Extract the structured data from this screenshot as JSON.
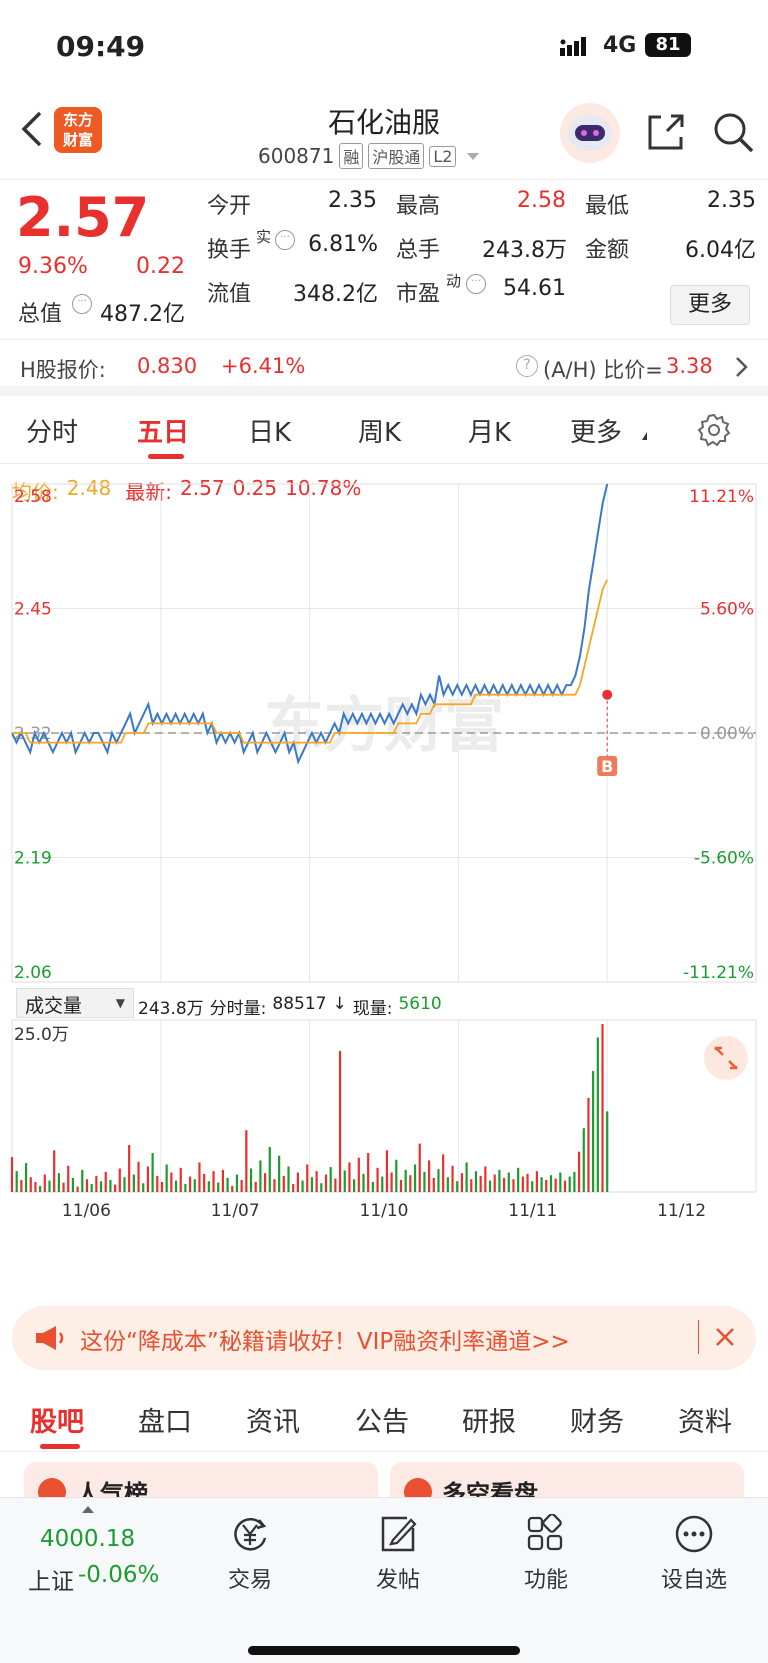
{
  "status_bar": {
    "time": "09:49",
    "network": "4G",
    "battery": "81"
  },
  "header": {
    "back_icon": "chevron-left-icon",
    "logo_text": "东方\n财富",
    "title": "石化油服",
    "code": "600871",
    "tags": [
      "融",
      "沪股通",
      "L2"
    ]
  },
  "quote": {
    "price": "2.57",
    "change_pct": "9.36%",
    "change": "0.22",
    "open_label": "今开",
    "open": "2.35",
    "high_label": "最高",
    "high": "2.58",
    "low_label": "最低",
    "low": "2.35",
    "turnover_label": "换手",
    "turnover_sup": "实",
    "turnover": "6.81%",
    "volume_label": "总手",
    "volume": "243.8万",
    "amount_label": "金额",
    "amount": "6.04亿",
    "mktcap_label": "总值",
    "mktcap": "487.2亿",
    "float_label": "流值",
    "float": "348.2亿",
    "pe_label": "市盈",
    "pe_sup": "动",
    "pe": "54.61",
    "more_label": "更多"
  },
  "h_share": {
    "label": "H股报价:",
    "price": "0.830",
    "change": "+6.41%",
    "ratio_label": "(A/H) 比价=",
    "ratio": "3.38"
  },
  "tabs": [
    "分时",
    "五日",
    "日K",
    "周K",
    "月K",
    "更多"
  ],
  "active_tab": "五日",
  "chart_header": {
    "avg_label": "均价:",
    "avg": "2.48",
    "latest_label": "最新:",
    "latest": "2.57",
    "change": "0.25",
    "pct": "10.78%"
  },
  "volume_header": {
    "selector": "成交量",
    "total": "243.8万",
    "tick_label": "分时量:",
    "tick": "88517",
    "now_label": "现量:",
    "now": "5610",
    "scale": "25.0万"
  },
  "marker": "B",
  "watermark": "东方财富",
  "chart_data": {
    "type": "line",
    "title": "",
    "x_ticks": [
      "11/06",
      "11/07",
      "11/10",
      "11/11",
      "11/12"
    ],
    "y_ticks_left": [
      "2.58",
      "2.45",
      "2.32",
      "2.19",
      "2.06"
    ],
    "y_ticks_right": [
      "11.21%",
      "5.60%",
      "0.00%",
      "-5.60%",
      "-11.21%"
    ],
    "ylim": [
      2.06,
      2.58
    ],
    "prev_close": 2.32,
    "series": [
      {
        "name": "",
        "color": "#3a78c8",
        "values": [
          2.32,
          2.31,
          2.32,
          2.31,
          2.3,
          2.32,
          2.31,
          2.32,
          2.31,
          2.3,
          2.31,
          2.32,
          2.31,
          2.32,
          2.3,
          2.31,
          2.32,
          2.31,
          2.32,
          2.32,
          2.31,
          2.3,
          2.32,
          2.31,
          2.32,
          2.33,
          2.34,
          2.32,
          2.33,
          2.34,
          2.35,
          2.33,
          2.34,
          2.33,
          2.34,
          2.33,
          2.34,
          2.33,
          2.34,
          2.33,
          2.34,
          2.33,
          2.34,
          2.32,
          2.33,
          2.31,
          2.32,
          2.31,
          2.32,
          2.31,
          2.32,
          2.3,
          2.31,
          2.32,
          2.3,
          2.31,
          2.32,
          2.31,
          2.3,
          2.31,
          2.32,
          2.3,
          2.31,
          2.29,
          2.3,
          2.31,
          2.32,
          2.31,
          2.32,
          2.31,
          2.32,
          2.33,
          2.32,
          2.34,
          2.33,
          2.34,
          2.33,
          2.34,
          2.33,
          2.34,
          2.33,
          2.34,
          2.33,
          2.34,
          2.33,
          2.34,
          2.35,
          2.34,
          2.35,
          2.34,
          2.36,
          2.35,
          2.36,
          2.35,
          2.38,
          2.36,
          2.37,
          2.36,
          2.37,
          2.36,
          2.37,
          2.36,
          2.37,
          2.36,
          2.37,
          2.36,
          2.37,
          2.36,
          2.37,
          2.36,
          2.37,
          2.36,
          2.37,
          2.36,
          2.37,
          2.36,
          2.37,
          2.36,
          2.37,
          2.36,
          2.37,
          2.36,
          2.37,
          2.37,
          2.38,
          2.4,
          2.43,
          2.47,
          2.5,
          2.53,
          2.56,
          2.58
        ]
      },
      {
        "name": "",
        "color": "#f5a623",
        "values": [
          2.32,
          2.32,
          2.32,
          2.32,
          2.31,
          2.31,
          2.31,
          2.31,
          2.31,
          2.31,
          2.31,
          2.31,
          2.31,
          2.31,
          2.31,
          2.31,
          2.31,
          2.31,
          2.31,
          2.31,
          2.31,
          2.31,
          2.31,
          2.31,
          2.31,
          2.32,
          2.32,
          2.32,
          2.32,
          2.32,
          2.33,
          2.33,
          2.33,
          2.33,
          2.33,
          2.33,
          2.33,
          2.33,
          2.33,
          2.33,
          2.33,
          2.33,
          2.33,
          2.33,
          2.33,
          2.32,
          2.32,
          2.32,
          2.32,
          2.32,
          2.32,
          2.31,
          2.31,
          2.31,
          2.31,
          2.31,
          2.31,
          2.31,
          2.31,
          2.31,
          2.31,
          2.31,
          2.31,
          2.31,
          2.31,
          2.31,
          2.31,
          2.31,
          2.31,
          2.31,
          2.31,
          2.32,
          2.32,
          2.32,
          2.32,
          2.32,
          2.32,
          2.32,
          2.32,
          2.32,
          2.32,
          2.32,
          2.32,
          2.32,
          2.32,
          2.33,
          2.33,
          2.33,
          2.33,
          2.33,
          2.34,
          2.34,
          2.34,
          2.35,
          2.35,
          2.35,
          2.35,
          2.35,
          2.35,
          2.35,
          2.35,
          2.35,
          2.36,
          2.36,
          2.36,
          2.36,
          2.36,
          2.36,
          2.36,
          2.36,
          2.36,
          2.36,
          2.36,
          2.36,
          2.36,
          2.36,
          2.36,
          2.36,
          2.36,
          2.36,
          2.36,
          2.36,
          2.36,
          2.36,
          2.36,
          2.37,
          2.39,
          2.41,
          2.43,
          2.45,
          2.47,
          2.48
        ]
      }
    ]
  },
  "volume_data": {
    "ymax": 250000,
    "bars": [
      52000,
      31000,
      18000,
      43000,
      22000,
      15000,
      9000,
      26000,
      17000,
      62000,
      28000,
      14000,
      39000,
      21000,
      8000,
      33000,
      19000,
      12000,
      24000,
      16000,
      30000,
      18000,
      11000,
      35000,
      22000,
      70000,
      26000,
      45000,
      13000,
      38000,
      58000,
      24000,
      15000,
      41000,
      29000,
      17000,
      36000,
      12000,
      23000,
      19000,
      44000,
      27000,
      16000,
      31000,
      14000,
      33000,
      21000,
      9000,
      26000,
      18000,
      92000,
      35000,
      15000,
      47000,
      28000,
      67000,
      19000,
      54000,
      24000,
      38000,
      12000,
      29000,
      17000,
      41000,
      22000,
      31000,
      13000,
      26000,
      37000,
      20000,
      210000,
      32000,
      44000,
      19000,
      51000,
      27000,
      58000,
      15000,
      36000,
      23000,
      62000,
      29000,
      48000,
      18000,
      33000,
      25000,
      41000,
      72000,
      30000,
      47000,
      21000,
      34000,
      56000,
      22000,
      39000,
      16000,
      28000,
      44000,
      19000,
      31000,
      24000,
      38000,
      17000,
      26000,
      33000,
      21000,
      29000,
      19000,
      36000,
      23000,
      27000,
      16000,
      31000,
      22000,
      18000,
      25000,
      20000,
      29000,
      17000,
      23000,
      30000,
      60000,
      95000,
      140000,
      180000,
      230000,
      250000,
      120000
    ],
    "colors": [
      "r",
      "g",
      "r",
      "g",
      "r",
      "r",
      "g",
      "r",
      "g",
      "r",
      "g",
      "r",
      "r",
      "g",
      "r",
      "g",
      "r",
      "g",
      "r",
      "g",
      "r",
      "g",
      "r",
      "r",
      "g",
      "r",
      "g",
      "r",
      "g",
      "r",
      "g",
      "r",
      "r",
      "g",
      "r",
      "g",
      "r",
      "g",
      "r",
      "g",
      "r",
      "r",
      "g",
      "r",
      "g",
      "r",
      "g",
      "r",
      "g",
      "r",
      "r",
      "g",
      "r",
      "g",
      "r",
      "g",
      "r",
      "g",
      "r",
      "g",
      "r",
      "r",
      "g",
      "r",
      "g",
      "r",
      "g",
      "r",
      "g",
      "r",
      "r",
      "g",
      "r",
      "g",
      "r",
      "g",
      "r",
      "g",
      "r",
      "g",
      "r",
      "r",
      "g",
      "r",
      "g",
      "r",
      "g",
      "r",
      "g",
      "r",
      "r",
      "g",
      "r",
      "g",
      "r",
      "g",
      "r",
      "g",
      "r",
      "g",
      "r",
      "r",
      "g",
      "r",
      "g",
      "r",
      "g",
      "r",
      "g",
      "r",
      "r",
      "g",
      "r",
      "g",
      "r",
      "g",
      "r",
      "g",
      "r",
      "g",
      "g",
      "r",
      "g",
      "r",
      "g",
      "g",
      "r",
      "g"
    ]
  },
  "ad": {
    "text": "这份“降成本”秘籍请收好！VIP融资利率通道>>"
  },
  "sub_tabs": [
    "股吧",
    "盘口",
    "资讯",
    "公告",
    "研报",
    "财务",
    "资料"
  ],
  "cards": [
    "人气榜",
    "多空看盘"
  ],
  "bottom_bar": {
    "index_value": "4000.18",
    "index_name": "上证",
    "index_change": "-0.06%",
    "items": [
      "交易",
      "发帖",
      "功能",
      "设自选"
    ]
  }
}
